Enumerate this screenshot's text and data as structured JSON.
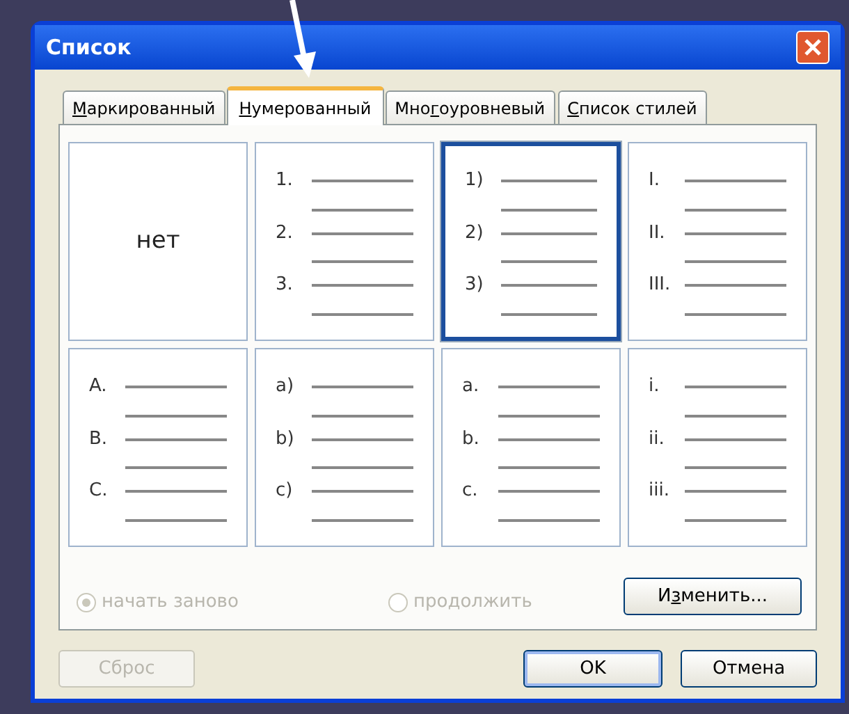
{
  "window": {
    "title": "Список"
  },
  "tabs": [
    {
      "access_key": "М",
      "label_after": "аркированный",
      "selected": false
    },
    {
      "access_key": "Н",
      "label_after": "умерованный",
      "selected": true
    },
    {
      "label_before": "Мно",
      "access_key": "г",
      "label_after": "оуровневый",
      "selected": false
    },
    {
      "access_key": "С",
      "label_after": "писок стилей",
      "selected": false
    }
  ],
  "styles": [
    {
      "kind": "none",
      "label": "нет",
      "selected": false
    },
    {
      "kind": "list",
      "markers": [
        "1.",
        "2.",
        "3."
      ],
      "selected": false
    },
    {
      "kind": "list",
      "markers": [
        "1)",
        "2)",
        "3)"
      ],
      "selected": true
    },
    {
      "kind": "list",
      "markers": [
        "I.",
        "II.",
        "III."
      ],
      "selected": false
    },
    {
      "kind": "list",
      "markers": [
        "A.",
        "B.",
        "C."
      ],
      "selected": false
    },
    {
      "kind": "list",
      "markers": [
        "a)",
        "b)",
        "c)"
      ],
      "selected": false
    },
    {
      "kind": "list",
      "markers": [
        "a.",
        "b.",
        "c."
      ],
      "selected": false
    },
    {
      "kind": "list",
      "markers": [
        "i.",
        "ii.",
        "iii."
      ],
      "selected": false
    }
  ],
  "numbering": [
    {
      "label": "начать заново",
      "selected": true,
      "disabled": true
    },
    {
      "label": "продолжить",
      "selected": false,
      "disabled": true
    }
  ],
  "modify_button": {
    "label_before": "И",
    "access_key": "з",
    "label_after": "менить..."
  },
  "buttons": [
    {
      "label": "Сброс",
      "disabled": true,
      "default": false
    },
    {
      "label": "OK",
      "disabled": false,
      "default": true
    },
    {
      "label": "Отмена",
      "disabled": false,
      "default": false
    }
  ]
}
